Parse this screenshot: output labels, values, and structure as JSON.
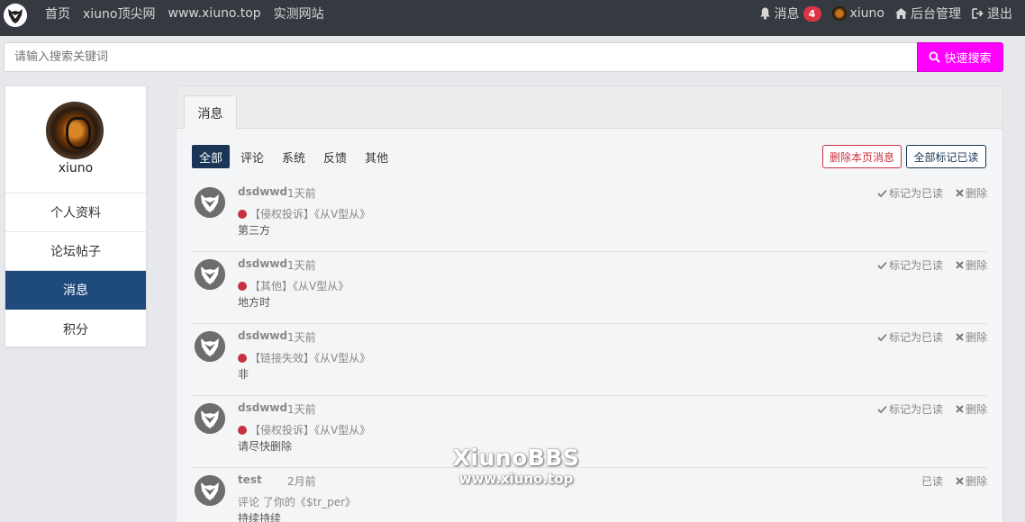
{
  "topnav": {
    "links": [
      "首页",
      "xiuno顶尖网",
      "www.xiuno.top",
      "实测网站"
    ],
    "messages_label": "消息",
    "messages_count": "4",
    "user_name": "xiuno",
    "admin_label": "后台管理",
    "logout_label": "退出"
  },
  "search": {
    "placeholder": "请输入搜索关键词",
    "button_label": "快速搜索"
  },
  "sidebar": {
    "user_name": "xiuno",
    "items": [
      {
        "label": "个人资料",
        "active": false
      },
      {
        "label": "论坛帖子",
        "active": false
      },
      {
        "label": "消息",
        "active": true
      },
      {
        "label": "积分",
        "active": false
      }
    ]
  },
  "main": {
    "tab_label": "消息",
    "filters": [
      "全部",
      "评论",
      "系统",
      "反馈",
      "其他"
    ],
    "active_filter": "全部",
    "delete_page_label": "删除本页消息",
    "mark_all_read_label": "全部标记已读",
    "messages": [
      {
        "user": "dsdwwd",
        "time": "1天前",
        "line1": "【侵权投诉】《从V型从》",
        "line2": "第三方",
        "mark_label": "标记为已读",
        "delete_label": "删除",
        "unread": true
      },
      {
        "user": "dsdwwd",
        "time": "1天前",
        "line1": "【其他】《从V型从》",
        "line2": "地方时",
        "mark_label": "标记为已读",
        "delete_label": "删除",
        "unread": true
      },
      {
        "user": "dsdwwd",
        "time": "1天前",
        "line1": "【链接失效】《从V型从》",
        "line2": "非",
        "mark_label": "标记为已读",
        "delete_label": "删除",
        "unread": true
      },
      {
        "user": "dsdwwd",
        "time": "1天前",
        "line1": "【侵权投诉】《从V型从》",
        "line2": "请尽快删除",
        "mark_label": "标记为已读",
        "delete_label": "删除",
        "unread": true
      },
      {
        "user": "test",
        "time": "2月前",
        "line1": "评论 了你的《$tr_per》",
        "line2": "持续持续",
        "mark_label": "已读",
        "delete_label": "删除",
        "unread": false
      }
    ]
  },
  "watermark": {
    "title": "XiunoBBS",
    "url": "www.xiuno.top"
  },
  "colors": {
    "nav_bg": "#343a40",
    "search_button": "#ff00ff",
    "sidebar_active": "#1e4a7c",
    "filter_active": "#1a3555",
    "unread_dot": "#c8323f",
    "badge": "#dc3545"
  }
}
